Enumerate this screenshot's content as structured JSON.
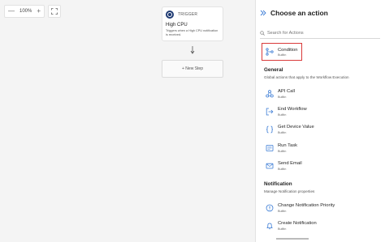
{
  "canvas": {
    "zoom": {
      "minus": "—",
      "value": "100%",
      "plus": "+"
    },
    "trigger": {
      "tag": "TRIGGER",
      "title": "High CPU",
      "description": "Triggers when a High CPU notification is received."
    },
    "new_step_label": "+ New Step"
  },
  "panel": {
    "title": "Choose an action",
    "search_placeholder": "Search for Actions",
    "condition": {
      "label": "Condition",
      "sub": "Builtin"
    },
    "general": {
      "title": "General",
      "description": "Global actions that apply to the Workflow Execution",
      "items": [
        {
          "label": "API Call",
          "sub": "Builtin",
          "icon": "api-call-icon"
        },
        {
          "label": "End Workflow",
          "sub": "Builtin",
          "icon": "end-workflow-icon"
        },
        {
          "label": "Get Device Value",
          "sub": "Builtin",
          "icon": "braces-icon"
        },
        {
          "label": "Run Task",
          "sub": "Builtin",
          "icon": "run-task-icon"
        },
        {
          "label": "Send Email",
          "sub": "Builtin",
          "icon": "mail-icon"
        }
      ]
    },
    "notification": {
      "title": "Notification",
      "description": "Manage Notification properties",
      "items": [
        {
          "label": "Change Notification Priority",
          "sub": "Builtin",
          "icon": "priority-icon"
        },
        {
          "label": "Create Notification",
          "sub": "Builtin",
          "icon": "bell-icon"
        }
      ]
    }
  },
  "colors": {
    "accent": "#3a7bd5",
    "highlight": "#d93a3a",
    "trigger_icon": "#1f3b73"
  }
}
